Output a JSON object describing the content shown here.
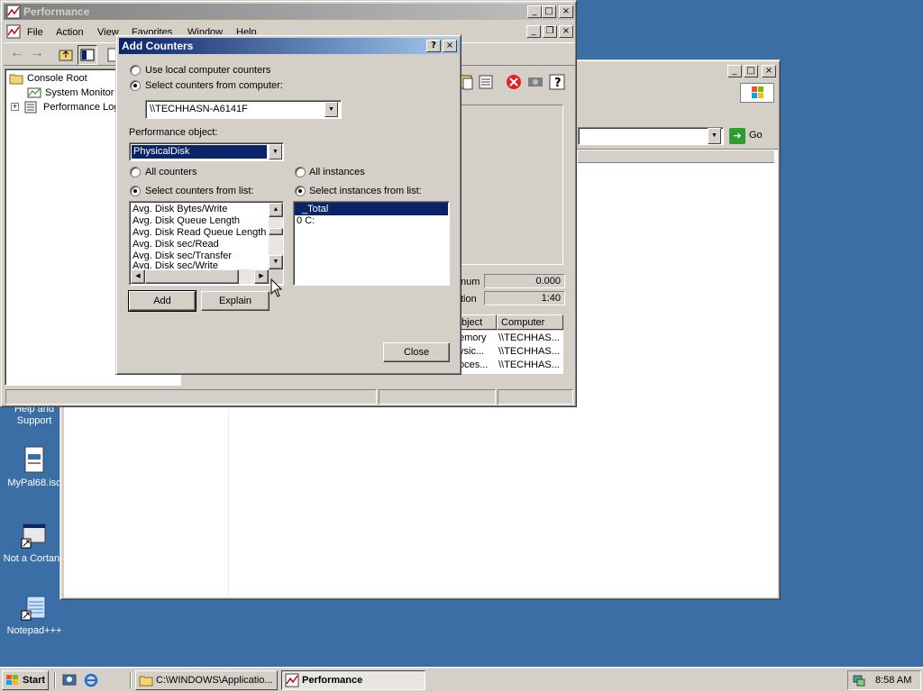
{
  "desktop": {
    "icons": [
      {
        "label": "Help and Support"
      },
      {
        "label": "MyPal68.isc"
      },
      {
        "label": "Not a Cortana"
      },
      {
        "label": "Notepad+++"
      }
    ]
  },
  "back_window": {
    "go_label": "Go",
    "table": {
      "stat_rows": [
        {
          "label_suffix": "num",
          "value": "0.000"
        },
        {
          "label_suffix": "tion",
          "value": "1:40"
        }
      ],
      "headers": [
        "bject",
        "Computer"
      ],
      "rows": [
        {
          "object": "emory",
          "computer": "\\\\TECHHAS..."
        },
        {
          "object": "ysic...",
          "computer": "\\\\TECHHAS..."
        },
        {
          "object": "oces...",
          "computer": "\\\\TECHHAS..."
        }
      ]
    }
  },
  "perf_window": {
    "title": "Performance",
    "menu": [
      "File",
      "Action",
      "View",
      "Favorites",
      "Window",
      "Help"
    ],
    "tree": [
      {
        "label": "Console Root"
      },
      {
        "label": "System Monitor"
      },
      {
        "label": "Performance Log"
      }
    ]
  },
  "dialog": {
    "title": "Add Counters",
    "help_btn": "?",
    "close_btn": "×",
    "radio_local": "Use local computer counters",
    "radio_select_computer": "Select counters from computer:",
    "computer_value": "\\\\TECHHASN-A6141F",
    "perf_object_label": "Performance object:",
    "perf_object_value": "PhysicalDisk",
    "all_counters": "All counters",
    "select_counters": "Select counters from list:",
    "all_instances": "All instances",
    "select_instances": "Select instances from list:",
    "counters": [
      "Avg. Disk Bytes/Write",
      "Avg. Disk Queue Length",
      "Avg. Disk Read Queue Length",
      "Avg. Disk sec/Read",
      "Avg. Disk sec/Transfer",
      "Avg. Disk sec/Write"
    ],
    "instances": [
      "_Total",
      "0 C:"
    ],
    "add_btn": "Add",
    "explain_btn": "Explain",
    "close_button": "Close"
  },
  "taskbar": {
    "start": "Start",
    "tasks": [
      {
        "label": "C:\\WINDOWS\\Applicatio...",
        "active": false
      },
      {
        "label": "Performance",
        "active": true
      }
    ],
    "clock": "8:58 AM"
  },
  "colors": {
    "desktop": "#3a6ea5",
    "title_active": "#0a246a",
    "selection": "#0a246a",
    "face": "#d4d0c8"
  }
}
